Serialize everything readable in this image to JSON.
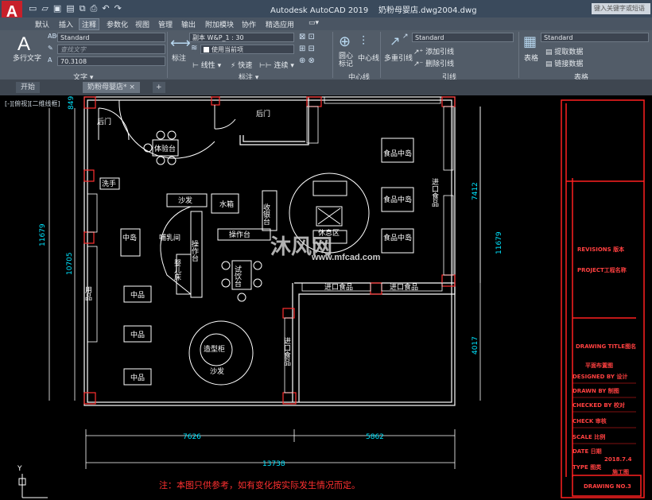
{
  "app": {
    "logo_letter": "A",
    "title": "Autodesk AutoCAD 2019",
    "filename": "奶粉母婴店.dwg2004.dwg",
    "search_placeholder": "键入关键字或短语"
  },
  "ribbon_tabs": [
    "默认",
    "插入",
    "注释",
    "参数化",
    "视图",
    "管理",
    "输出",
    "附加模块",
    "协作",
    "精选应用"
  ],
  "active_ribbon_tab": "注释",
  "text_panel": {
    "big_button": "多行文字",
    "style": "Standard",
    "find_placeholder": "查找文字",
    "height": "70.3108",
    "panel_label": "文字"
  },
  "dim_panel": {
    "big_button": "标注",
    "style": "副本 W&P_1 : 30",
    "layer": "使用当前项",
    "linear": "线性",
    "quick": "快速",
    "continue": "连续",
    "panel_label": "标注"
  },
  "centerline_panel": {
    "center_mark": "圆心标记",
    "centerline": "中心线",
    "panel_label": "中心线"
  },
  "leader_panel": {
    "multileader": "多重引线",
    "style": "Standard",
    "add": "添加引线",
    "remove": "删除引线",
    "panel_label": "引线"
  },
  "table_panel": {
    "table": "表格",
    "style": "Standard",
    "extract": "提取数据",
    "link": "链接数据",
    "panel_label": "表格"
  },
  "doc_tabs": [
    "开始",
    "奶粉母婴店*"
  ],
  "view_label": "[-][俯视][二维线框]",
  "drawing": {
    "rooms": [
      "后门",
      "后门",
      "体验台",
      "沙发",
      "水箱",
      "收银台",
      "操作台",
      "中岛",
      "哺乳间",
      "操作台",
      "婴儿床",
      "试饮台",
      "休息区",
      "食品中岛",
      "食品中岛",
      "食品中岛",
      "进口食品",
      "进口食品",
      "进口食品",
      "进口食品",
      "用品",
      "中品",
      "中品",
      "中品",
      "洗手",
      "造型柜",
      "沙发"
    ],
    "dims": {
      "left_h": "10705",
      "left_total": "11679",
      "right_total": "11679",
      "right_top": "7412",
      "right_bottom": "4017",
      "bottom_a": "7626",
      "bottom_b": "5862",
      "bottom_total": "13738",
      "top_small": "849"
    },
    "note": "注：本图只供参考，如有变化按实际发生情况而定。"
  },
  "title_block": {
    "revisions": "REVISIONS 版本",
    "project": "PROJECT工程名称",
    "drawing_title": "DRAWING TITLE图名",
    "plan_name": "平面布置图",
    "designed": "DESIGNED BY 设计",
    "drawn": "DRAWN BY 制图",
    "checked": "CHECKED BY 校对",
    "check": "CHECK 审核",
    "scale": "SCALE 比例",
    "date": "DATE 日期",
    "date_value": "2018.7.4",
    "type": "TYPE 图类",
    "type_value": "施工图",
    "drawing_no": "DRAWING NO.3"
  },
  "watermark": {
    "text": "沐风网",
    "url": "www.mfcad.com"
  },
  "colors": {
    "wall": "#ffffff",
    "dim": "#00e5ff",
    "red": "#ff2020",
    "text": "#ffffff"
  }
}
